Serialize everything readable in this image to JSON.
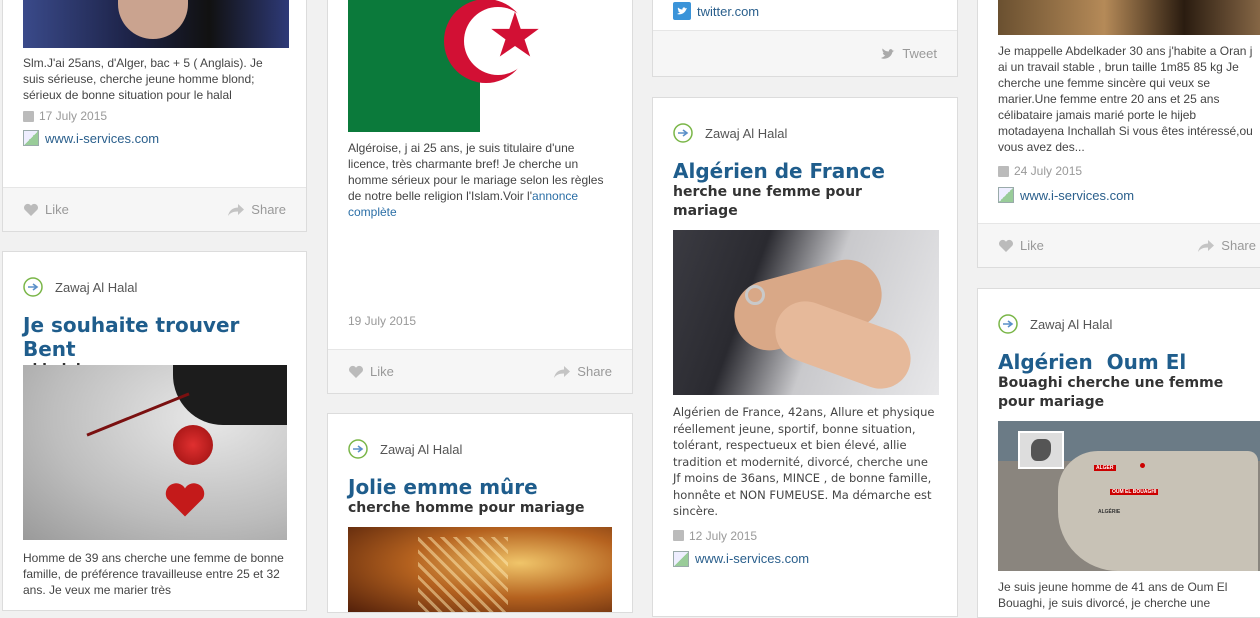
{
  "brand": {
    "name": "Zawaj Al Halal",
    "logo_icon": "zawaj-logo-icon"
  },
  "actions": {
    "like": "Like",
    "share": "Share",
    "tweet": "Tweet"
  },
  "cards": {
    "c1": {
      "text": "Slm.J'ai 25ans, d'Alger, bac + 5 ( Anglais). Je suis sérieuse, cherche jeune homme blond; sérieux de bonne situation pour le halal",
      "date": "17 July 2015",
      "link": "www.i-services.com"
    },
    "c2": {
      "title": "Je souhaite trouver Bent",
      "subtitle": "el halal",
      "text": "Homme de 39 ans cherche une femme de bonne famille, de préférence travailleuse entre 25 et 32 ans. Je veux me marier très"
    },
    "c3": {
      "text_main": "Algéroise, j ai 25 ans, je suis titulaire d'une licence, très charmante bref! Je cherche un homme sérieux pour le mariage selon les règles de notre belle religion l'Islam.Voir l'",
      "text_link": "annonce complète",
      "date": "19 July 2015"
    },
    "c4": {
      "title": "Jolie emme mûre",
      "subtitle": "cherche homme pour mariage"
    },
    "c5": {
      "link": "twitter.com"
    },
    "c6": {
      "title": "Algérien de France",
      "subtitle": "herche une femme pour mariage",
      "text": "Algérien de France, 42ans, Allure et physique réellement jeune, sportif, bonne situation, tolérant, respectueux et bien élevé, allie tradition et modernité, divorcé, cherche une Jf moins de 36ans, MINCE , de bonne famille, honnête et NON FUMEUSE. Ma démarche est sincère.",
      "date": "12 July 2015",
      "link": "www.i-services.com"
    },
    "c7": {
      "text": "Je mappelle Abdelkader 30 ans j'habite a Oran j ai un travail stable , brun taille 1m85 85 kg Je cherche une femme sincère qui veux se marier.Une femme entre 20 ans et 25 ans célibataire jamais marié porte le hijeb motadayena Inchallah Si vous êtes intéressé,ou vous avez des...",
      "date": "24 July 2015",
      "link": "www.i-services.com"
    },
    "c8": {
      "title": "Algérien  Oum El",
      "subtitle": "Bouaghi cherche une femme pour mariage",
      "text": "Je suis jeune homme de 41 ans de Oum El Bouaghi, je suis divorcé, je cherche une",
      "map_labels": [
        "ALGER",
        "OUM EL BOUAGHI",
        "ALGÉRIE"
      ]
    }
  }
}
